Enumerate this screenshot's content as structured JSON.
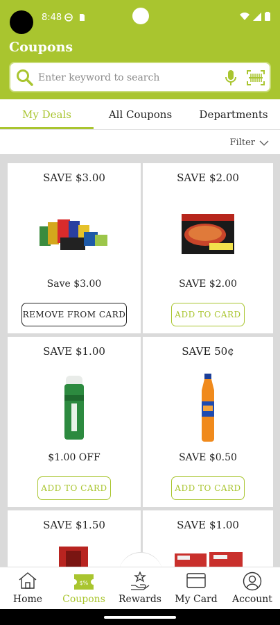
{
  "status": {
    "time": "8:48"
  },
  "header": {
    "title": "Coupons",
    "brand_color": "#a9c52f"
  },
  "search": {
    "placeholder": "Enter keyword to search"
  },
  "tabs": [
    {
      "label": "My Deals",
      "active": true
    },
    {
      "label": "All Coupons",
      "active": false
    },
    {
      "label": "Departments",
      "active": false
    }
  ],
  "filter": {
    "label": "Filter"
  },
  "coupons": [
    {
      "title": "SAVE $3.00",
      "subtitle": "Save $3.00",
      "button": "REMOVE FROM CARD",
      "image": "snack-bundle"
    },
    {
      "title": "SAVE $2.00",
      "subtitle": "SAVE $2.00",
      "button": "ADD TO CARD",
      "image": "pizza-box"
    },
    {
      "title": "SAVE $1.00",
      "subtitle": "$1.00 OFF",
      "button": "ADD TO CARD",
      "image": "green-spray-can"
    },
    {
      "title": "SAVE 50¢",
      "subtitle": "SAVE $0.50",
      "button": "ADD TO CARD",
      "image": "orange-soda-bottle"
    },
    {
      "title": "SAVE $1.50",
      "subtitle": "",
      "button": "",
      "image": "red-box"
    },
    {
      "title": "SAVE $1.00",
      "subtitle": "",
      "button": "",
      "image": "cereal-boxes"
    }
  ],
  "nav": [
    {
      "label": "Home",
      "icon": "home-icon",
      "active": false
    },
    {
      "label": "Coupons",
      "icon": "coupon-icon",
      "active": true
    },
    {
      "label": "Rewards",
      "icon": "rewards-icon",
      "active": false
    },
    {
      "label": "My Card",
      "icon": "card-icon",
      "active": false
    },
    {
      "label": "Account",
      "icon": "account-icon",
      "active": false
    }
  ]
}
